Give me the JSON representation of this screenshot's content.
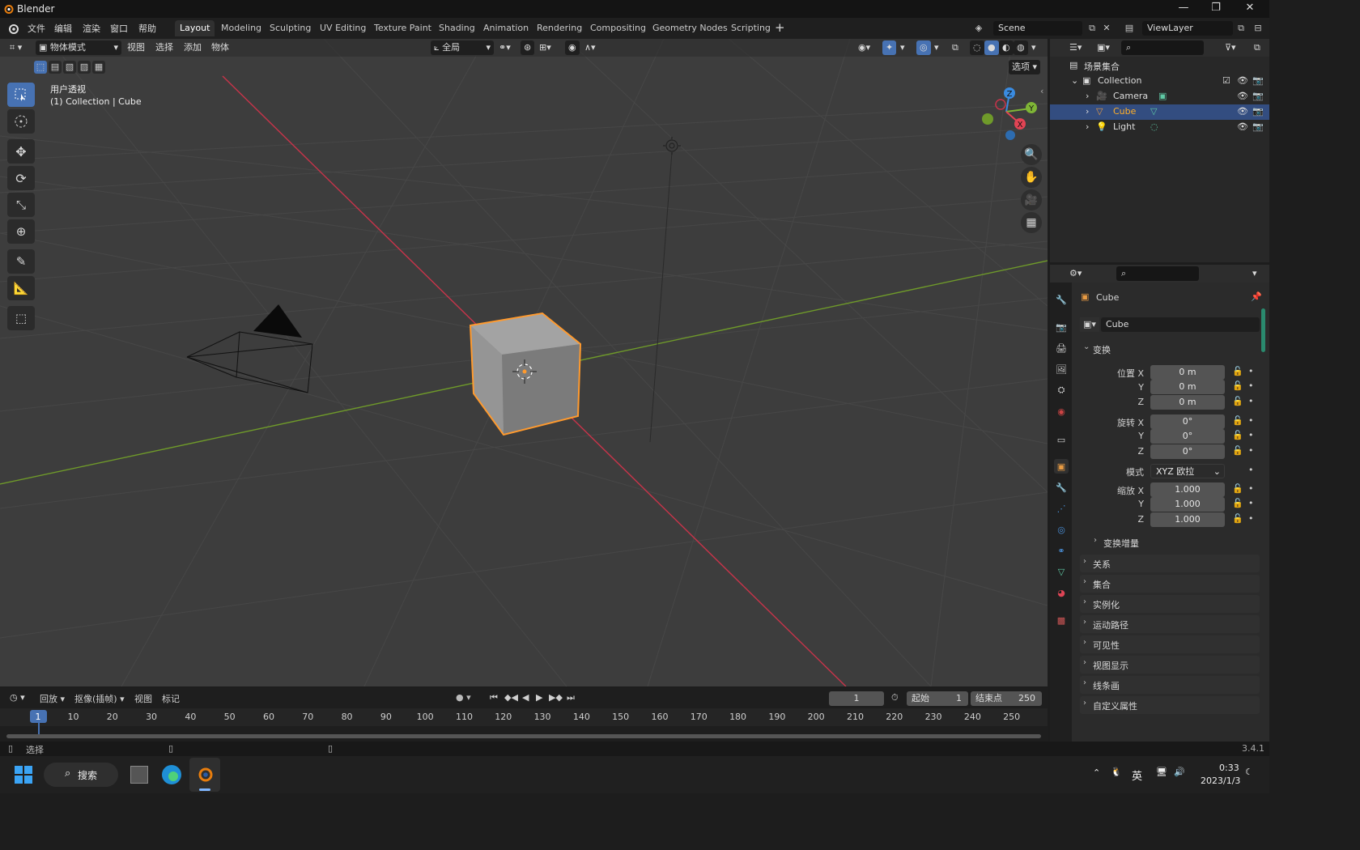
{
  "window": {
    "title": "Blender"
  },
  "topbar": {
    "menus": [
      "文件",
      "编辑",
      "渲染",
      "窗口",
      "帮助"
    ],
    "workspaces": [
      "Layout",
      "Modeling",
      "Sculpting",
      "UV Editing",
      "Texture Paint",
      "Shading",
      "Animation",
      "Rendering",
      "Compositing",
      "Geometry Nodes",
      "Scripting"
    ],
    "active_workspace": "Layout",
    "add_tab": "+",
    "scene": "Scene",
    "view_layer": "ViewLayer"
  },
  "viewport": {
    "mode": "物体模式",
    "menus": [
      "视图",
      "选择",
      "添加",
      "物体"
    ],
    "transform_orientation": "全局",
    "options_label": "选项",
    "overlay_title": "用户透视",
    "overlay_subtitle": "(1) Collection | Cube",
    "gizmo_axes": {
      "x": "X",
      "y": "Y",
      "z": "Z"
    }
  },
  "timeline": {
    "playback": "回放",
    "keying": "抠像(插帧)",
    "view": "视图",
    "marker": "标记",
    "current_frame": "1",
    "start_label": "起始",
    "start": "1",
    "end_label": "结束点",
    "end": "250",
    "ticks": [
      "1",
      "10",
      "20",
      "30",
      "40",
      "50",
      "60",
      "70",
      "80",
      "90",
      "100",
      "110",
      "120",
      "130",
      "140",
      "150",
      "160",
      "170",
      "180",
      "190",
      "200",
      "210",
      "220",
      "230",
      "240",
      "250"
    ]
  },
  "statusbar": {
    "left": "选择",
    "version": "3.4.1"
  },
  "outliner": {
    "root": "场景集合",
    "collection": "Collection",
    "items": [
      {
        "name": "Camera",
        "selected": false
      },
      {
        "name": "Cube",
        "selected": true
      },
      {
        "name": "Light",
        "selected": false
      }
    ]
  },
  "properties": {
    "object_name": "Cube",
    "datablock_name": "Cube",
    "transform_label": "变换",
    "location_label": "位置 X",
    "rotation_label": "旋转 X",
    "scale_label": "缩放 X",
    "axis_y": "Y",
    "axis_z": "Z",
    "location": [
      "0 m",
      "0 m",
      "0 m"
    ],
    "rotation": [
      "0°",
      "0°",
      "0°"
    ],
    "mode_label": "模式",
    "rotation_mode": "XYZ 欧拉",
    "scale": [
      "1.000",
      "1.000",
      "1.000"
    ],
    "delta_transform": "变换增量",
    "panels": [
      "关系",
      "集合",
      "实例化",
      "运动路径",
      "可见性",
      "视图显示",
      "线条画",
      "自定义属性"
    ]
  },
  "taskbar": {
    "search": "搜索",
    "ime": "英",
    "time": "0:33",
    "date": "2023/1/3"
  },
  "colors": {
    "selection_orange": "#ff9a2e",
    "x_axis": "#e24454",
    "y_axis": "#7fb536",
    "z_axis": "#3a8be0",
    "active_blue": "#4772b3"
  }
}
